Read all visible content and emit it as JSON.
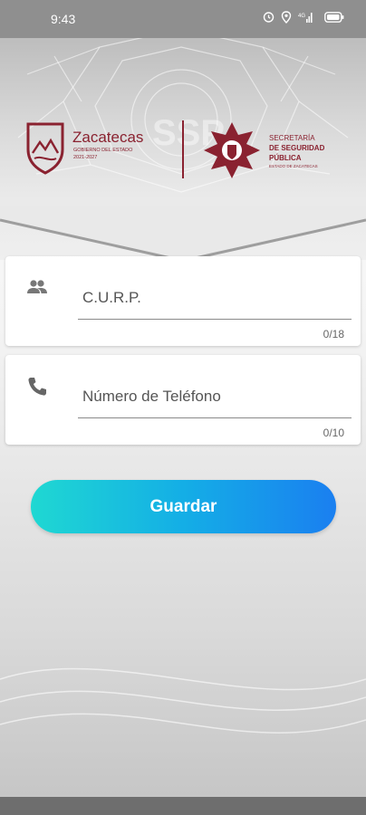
{
  "status_bar": {
    "time": "9:43",
    "icons": [
      "alarm-icon",
      "location-icon",
      "signal-icon",
      "battery-icon"
    ],
    "signal_text": "4G"
  },
  "header": {
    "logo_left": {
      "name": "Zacatecas",
      "line1": "GOBIERNO DEL ESTADO",
      "line2": "2021-2027"
    },
    "logo_right": {
      "line1": "SECRETARÍA",
      "line2": "DE SEGURIDAD",
      "line3": "PÚBLICA",
      "line4": "ESTADO DE ZACATECAS"
    },
    "watermark_text": "SSP"
  },
  "form": {
    "curp": {
      "placeholder": "C.U.R.P.",
      "value": "",
      "counter": "0/18",
      "icon": "people-icon"
    },
    "phone": {
      "placeholder": "Número de Teléfono",
      "value": "",
      "counter": "0/10",
      "icon": "phone-icon"
    },
    "save_label": "Guardar"
  },
  "colors": {
    "brand_maroon": "#8a2230",
    "button_start": "#1fd8d2",
    "button_end": "#1a7ff0",
    "status_bar": "#8f8f8f"
  }
}
